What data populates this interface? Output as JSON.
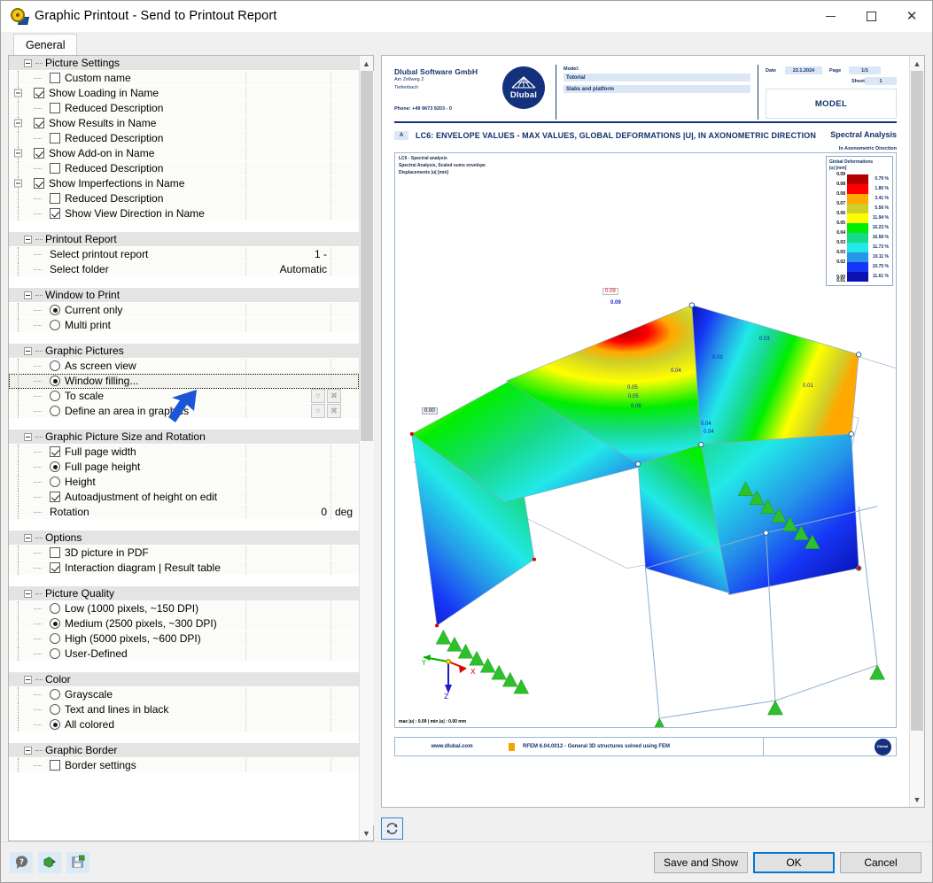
{
  "window": {
    "title": "Graphic Printout - Send to Printout Report",
    "icon": "printout-icon",
    "minimize": "—",
    "maximize": "☐",
    "close": "✕"
  },
  "tabs": [
    {
      "label": "General",
      "active": true
    }
  ],
  "groups": [
    {
      "name": "Picture Settings",
      "rows": [
        {
          "label": "Custom name",
          "control": "checkbox",
          "checked": false,
          "level": 2
        },
        {
          "label": "Show Loading in Name",
          "control": "checkbox",
          "checked": true,
          "level": 1,
          "node": true
        },
        {
          "label": "Reduced Description",
          "control": "checkbox",
          "checked": false,
          "level": 2
        },
        {
          "label": "Show Results in Name",
          "control": "checkbox",
          "checked": true,
          "level": 1,
          "node": true
        },
        {
          "label": "Reduced Description",
          "control": "checkbox",
          "checked": false,
          "level": 2
        },
        {
          "label": "Show Add-on in Name",
          "control": "checkbox",
          "checked": true,
          "level": 1,
          "node": true
        },
        {
          "label": "Reduced Description",
          "control": "checkbox",
          "checked": false,
          "level": 2
        },
        {
          "label": "Show Imperfections in Name",
          "control": "checkbox",
          "checked": true,
          "level": 1,
          "node": true
        },
        {
          "label": "Reduced Description",
          "control": "checkbox",
          "checked": false,
          "level": 2
        },
        {
          "label": "Show View Direction in Name",
          "control": "checkbox",
          "checked": true,
          "level": 2
        }
      ]
    },
    {
      "name": "Printout Report",
      "rows": [
        {
          "label": "Select printout report",
          "control": "none",
          "value": "1 -",
          "level": 2
        },
        {
          "label": "Select folder",
          "control": "none",
          "value": "Automatic",
          "level": 2
        }
      ]
    },
    {
      "name": "Window to Print",
      "rows": [
        {
          "label": "Current only",
          "control": "radio",
          "checked": true,
          "level": 2
        },
        {
          "label": "Multi print",
          "control": "radio",
          "checked": false,
          "level": 2
        }
      ]
    },
    {
      "name": "Graphic Pictures",
      "rows": [
        {
          "label": "As screen view",
          "control": "radio",
          "checked": false,
          "level": 2
        },
        {
          "label": "Window filling...",
          "control": "radio",
          "checked": true,
          "level": 2,
          "focused": true
        },
        {
          "label": "To scale",
          "control": "radio",
          "checked": false,
          "level": 2
        },
        {
          "label": "Define an area in graphics",
          "control": "radio",
          "checked": false,
          "level": 2
        }
      ]
    },
    {
      "name": "Graphic Picture Size and Rotation",
      "rows": [
        {
          "label": "Full page width",
          "control": "checkbox",
          "checked": true,
          "level": 2
        },
        {
          "label": "Full page height",
          "control": "radio",
          "checked": true,
          "level": 2
        },
        {
          "label": "Height",
          "control": "radio",
          "checked": false,
          "level": 2
        },
        {
          "label": "Autoadjustment of height on edit",
          "control": "checkbox",
          "checked": true,
          "level": 2
        },
        {
          "label": "Rotation",
          "control": "none",
          "value": "0",
          "unit": "deg",
          "level": 2
        }
      ]
    },
    {
      "name": "Options",
      "rows": [
        {
          "label": "3D picture in PDF",
          "control": "checkbox",
          "checked": false,
          "level": 2
        },
        {
          "label": "Interaction diagram | Result table",
          "control": "checkbox",
          "checked": true,
          "level": 2
        }
      ]
    },
    {
      "name": "Picture Quality",
      "rows": [
        {
          "label": "Low (1000 pixels, ~150 DPI)",
          "control": "radio",
          "checked": false,
          "level": 2
        },
        {
          "label": "Medium (2500 pixels, ~300 DPI)",
          "control": "radio",
          "checked": true,
          "level": 2
        },
        {
          "label": "High (5000 pixels, ~600 DPI)",
          "control": "radio",
          "checked": false,
          "level": 2
        },
        {
          "label": "User-Defined",
          "control": "radio",
          "checked": false,
          "level": 2
        }
      ]
    },
    {
      "name": "Color",
      "rows": [
        {
          "label": "Grayscale",
          "control": "radio",
          "checked": false,
          "level": 2
        },
        {
          "label": "Text and lines in black",
          "control": "radio",
          "checked": false,
          "level": 2
        },
        {
          "label": "All colored",
          "control": "radio",
          "checked": true,
          "level": 2
        }
      ]
    },
    {
      "name": "Graphic Border",
      "rows": [
        {
          "label": "Border settings",
          "control": "checkbox",
          "checked": false,
          "level": 2
        }
      ]
    }
  ],
  "side_buttons": {
    "pick": "pick-icon",
    "clear": "✖"
  },
  "preview": {
    "header": {
      "company_name": "Dlubal Software GmbH",
      "company_street": "Am Zellweg 2",
      "company_city": "Tiefenbach",
      "company_phone": "Phone: +49 9673 9203 - 0",
      "logo_text": "Dlubal",
      "model_key": "Model:",
      "model_name": "Tutorial",
      "model_desc": "Slabs and platform",
      "date_key": "Date",
      "date_value": "22.1.2024",
      "page_key": "Page",
      "page_value": "1/1",
      "sheet_key": "Sheet",
      "sheet_value": "1",
      "model_box": "MODEL"
    },
    "title_tag": "A",
    "title": "LC6: ENVELOPE VALUES - MAX VALUES, GLOBAL DEFORMATIONS |U|, IN AXONOMETRIC DIRECTION",
    "title_right": "Spectral Analysis",
    "axo_note": "In Axonometric Direction",
    "graphic_note": [
      "LC6 - Spectral analysis",
      "Spectral Analysis, Scaled sums envelope",
      "Displacements |u| [mm]"
    ],
    "max_min": "max |u| : 0.09  |  min |u| : 0.00 mm",
    "axes": {
      "x": "X",
      "y": "Y",
      "z": "Z"
    },
    "value_labels": [
      "0.09",
      "0.09",
      "0.00",
      "0.05",
      "0.05",
      "0.06",
      "0.04",
      "0.03",
      "0.03",
      "0.01",
      "0.04",
      "0.04"
    ],
    "footer": {
      "website": "www.dlubal.com",
      "product": "RFEM 6.04.0012 - General 3D structures solved using FEM",
      "logo_text": "Dlubal"
    },
    "refresh_button": "refresh-icon"
  },
  "chart_data": {
    "type": "heatmap",
    "title": "Global Deformations |u| [mm]",
    "subtitle": "In Axonometric Direction",
    "legend_title_line1": "Global Deformations",
    "legend_title_line2": "|u| [mm]",
    "ticks": [
      "0.09",
      "0.08",
      "0.08",
      "0.07",
      "0.06",
      "0.05",
      "0.04",
      "0.03",
      "0.03",
      "0.02",
      "0.01",
      "0.00"
    ],
    "bands": [
      {
        "color": "#b30000",
        "percent": "0.79 %"
      },
      {
        "color": "#ff0000",
        "percent": "1.80 %"
      },
      {
        "color": "#ffa800",
        "percent": "3.41 %"
      },
      {
        "color": "#cfcf29",
        "percent": "5.56 %"
      },
      {
        "color": "#ffff00",
        "percent": "11.94 %"
      },
      {
        "color": "#00ee00",
        "percent": "16.23 %"
      },
      {
        "color": "#18d98a",
        "percent": "16.58 %"
      },
      {
        "color": "#22e8e8",
        "percent": "11.73 %"
      },
      {
        "color": "#2596e8",
        "percent": "10.11 %"
      },
      {
        "color": "#1636f5",
        "percent": "10.75 %"
      },
      {
        "color": "#0a12b4",
        "percent": "11.61 %"
      }
    ],
    "max_value": 0.09,
    "min_value": 0.0,
    "unit": "mm"
  },
  "toolbar_bottom": {
    "help": "help-icon",
    "import": "import-settings-icon",
    "save": "save-settings-icon"
  },
  "buttons": {
    "save_and_show": "Save and Show",
    "ok": "OK",
    "cancel": "Cancel"
  },
  "colors": {
    "accent": "#0078d7",
    "brand": "#14317d",
    "group_header": "#e4e4e4",
    "annotation_arrow": "#1a56d6"
  }
}
